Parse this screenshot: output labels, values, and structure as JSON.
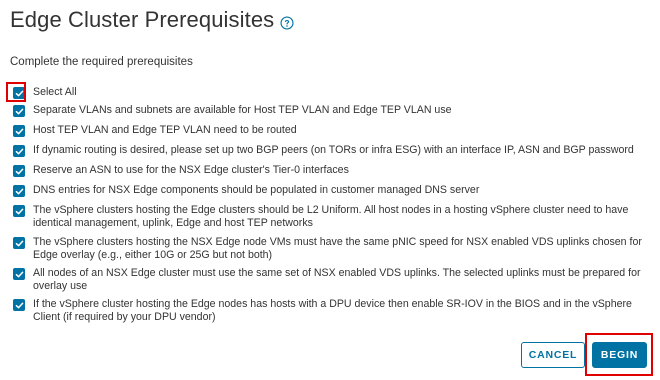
{
  "header": {
    "title": "Edge Cluster Prerequisites",
    "help_icon": "question-circle-icon"
  },
  "subtitle": "Complete the required prerequisites",
  "select_all": {
    "label": "Select All",
    "checked": true
  },
  "prerequisites": [
    {
      "label": "Separate VLANs and subnets are available for Host TEP VLAN and Edge TEP VLAN use",
      "checked": true
    },
    {
      "label": "Host TEP VLAN and Edge TEP VLAN need to be routed",
      "checked": true
    },
    {
      "label": "If dynamic routing is desired, please set up two BGP peers (on TORs or infra ESG) with an interface IP, ASN and BGP password",
      "checked": true
    },
    {
      "label": "Reserve an ASN to use for the NSX Edge cluster's Tier-0 interfaces",
      "checked": true
    },
    {
      "label": "DNS entries for NSX Edge components should be populated in customer managed DNS server",
      "checked": true
    },
    {
      "label": "The vSphere clusters hosting the Edge clusters should be L2 Uniform. All host nodes in a hosting vSphere cluster need to have identical management, uplink, Edge and host TEP networks",
      "checked": true
    },
    {
      "label": "The vSphere clusters hosting the NSX Edge node VMs must have the same pNIC speed for NSX enabled VDS uplinks chosen for Edge overlay (e.g., either 10G or 25G but not both)",
      "checked": true
    },
    {
      "label": "All nodes of an NSX Edge cluster must use the same set of NSX enabled VDS uplinks. The selected uplinks must be prepared for overlay use",
      "checked": true
    },
    {
      "label": "If the vSphere cluster hosting the Edge nodes has hosts with a DPU device then enable SR-IOV in the BIOS and in the vSphere Client (if required by your DPU vendor)",
      "checked": true
    }
  ],
  "footer": {
    "cancel_label": "CANCEL",
    "begin_label": "BEGIN"
  },
  "colors": {
    "accent": "#0072a3",
    "highlight": "#e00000",
    "text": "#333333"
  }
}
